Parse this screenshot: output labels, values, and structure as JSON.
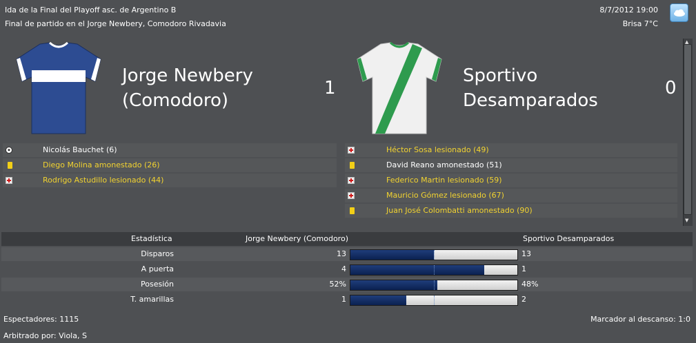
{
  "header": {
    "title": "Ida de la Final del Playoff asc. de Argentino B",
    "subtitle": "Final de partido en el Jorge Newbery, Comodoro Rivadavia",
    "datetime": "8/7/2012 19:00",
    "weather": "Brisa 7°C",
    "weather_icon": "cloud-icon"
  },
  "home": {
    "name_line1": "Jorge Newbery",
    "name_line2": "(Comodoro)",
    "score": "1",
    "kit_colors": {
      "body": "#2b4a8f",
      "band": "#ffffff"
    },
    "events": [
      {
        "icon": "goal-ball-icon",
        "text": "Nicolás Bauchet (6)",
        "color": "white"
      },
      {
        "icon": "yellow-card-icon",
        "text": "Diego Molina amonestado (26)",
        "color": "yellow"
      },
      {
        "icon": "injury-icon",
        "text": "Rodrigo Astudillo lesionado (44)",
        "color": "yellow"
      }
    ]
  },
  "away": {
    "name_line1": "Sportivo",
    "name_line2": "Desamparados",
    "score": "0",
    "kit_colors": {
      "body": "#f2f2f2",
      "sash": "#2e9b4e"
    },
    "events": [
      {
        "icon": "injury-icon",
        "text": "Héctor Sosa lesionado (49)",
        "color": "yellow"
      },
      {
        "icon": "yellow-card-icon",
        "text": "David Reano amonestado (51)",
        "color": "white"
      },
      {
        "icon": "injury-icon",
        "text": "Federico Martin lesionado (59)",
        "color": "yellow"
      },
      {
        "icon": "injury-icon",
        "text": "Mauricio Gómez lesionado (67)",
        "color": "yellow"
      },
      {
        "icon": "yellow-card-icon",
        "text": "Juan José Colombatti amonestado (90)",
        "color": "yellow"
      }
    ]
  },
  "stats": {
    "col_stat": "Estadística",
    "col_home": "Jorge Newbery (Comodoro)",
    "col_away": "Sportivo Desamparados",
    "rows": [
      {
        "label": "Disparos",
        "home": "13",
        "away": "13",
        "home_share": 0.5
      },
      {
        "label": "A puerta",
        "home": "4",
        "away": "1",
        "home_share": 0.8
      },
      {
        "label": "Posesión",
        "home": "52%",
        "away": "48%",
        "home_share": 0.52
      },
      {
        "label": "T. amarillas",
        "home": "1",
        "away": "2",
        "home_share": 0.333
      }
    ]
  },
  "footer": {
    "spectators": "Espectadores: 1115",
    "halftime": "Marcador al descanso: 1:0",
    "referee": "Arbitrado por: Viola, S"
  },
  "colors": {
    "background": "#4e5053",
    "bar_fill": "#0b2150",
    "highlight_text": "#f2d330"
  }
}
